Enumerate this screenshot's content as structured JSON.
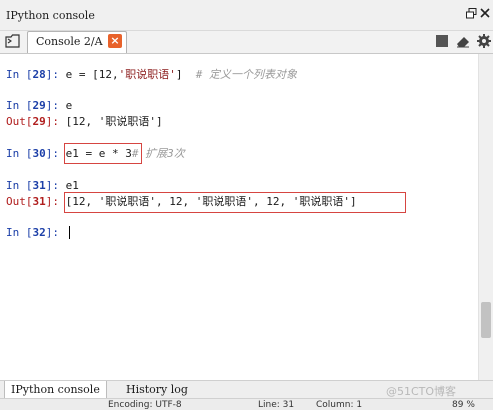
{
  "pane": {
    "title": "IPython console"
  },
  "tab": {
    "label": "Console 2/A",
    "close_glyph": "×"
  },
  "console": {
    "lines": [
      {
        "prompt_prefix": "In [",
        "n": "28",
        "prompt_suffix": "]: ",
        "code": "e = [12,",
        "string": "'职说职语'",
        "code_after": "]",
        "comment": "  # 定义一个列表对象"
      },
      {
        "prompt_prefix": "In [",
        "n": "29",
        "prompt_suffix": "]: ",
        "code": "e"
      },
      {
        "prompt_prefix": "Out[",
        "n": "29",
        "prompt_suffix": "]: ",
        "code": "[12, '职说职语']"
      },
      {
        "prompt_prefix": "In [",
        "n": "30",
        "prompt_suffix": "]: ",
        "code": "e1 = e * 3",
        "comment": "# 扩展3次"
      },
      {
        "prompt_prefix": "In [",
        "n": "31",
        "prompt_suffix": "]: ",
        "code": "e1"
      },
      {
        "prompt_prefix": "Out[",
        "n": "31",
        "prompt_suffix": "]: ",
        "code": "[12, '职说职语', 12, '职说职语', 12, '职说职语']"
      },
      {
        "prompt_prefix": "In [",
        "n": "32",
        "prompt_suffix": "]: ",
        "code": ""
      }
    ]
  },
  "bottom_tabs": [
    "IPython console",
    "History log"
  ],
  "watermark": "@51CTO博客",
  "status": {
    "encoding": "Encoding: UTF-8",
    "line": "Line: 31",
    "column": "Column: 1",
    "memory": "89 %"
  },
  "colors": {
    "accent_close": "#e8622b",
    "highlight_box": "#d64541",
    "in_prompt": "#1c3fa8",
    "out_prompt": "#b01d1d"
  }
}
